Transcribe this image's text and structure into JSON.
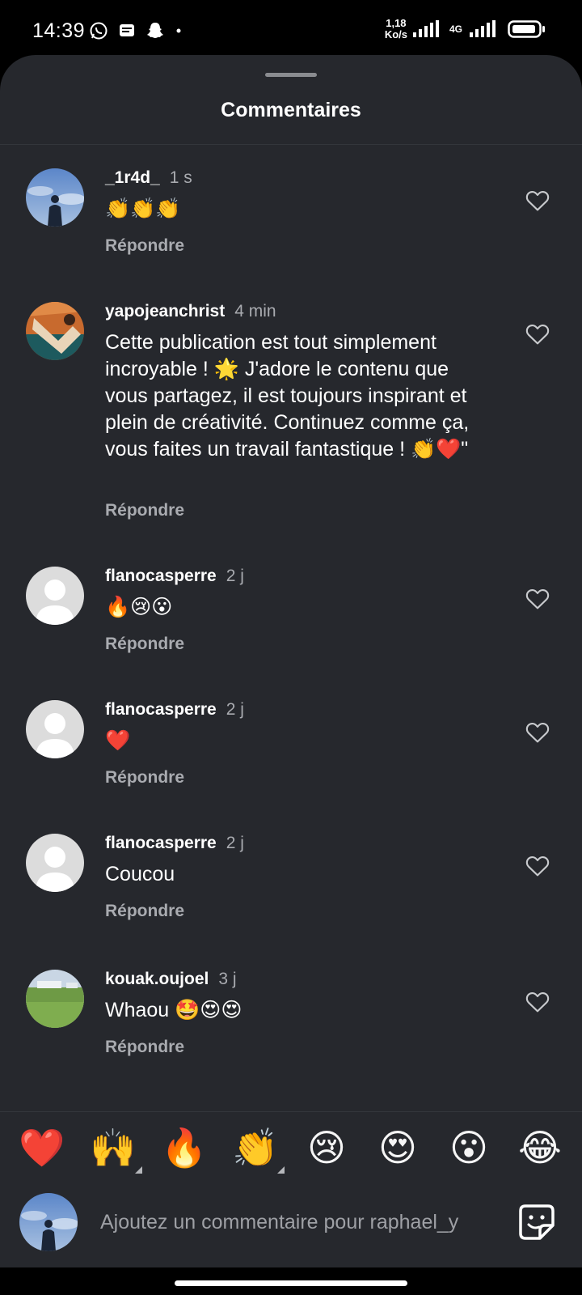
{
  "status_bar": {
    "time": "14:39",
    "net_speed_value": "1,18",
    "net_speed_unit": "Ko/s",
    "net_type": "4G",
    "icons": [
      "whatsapp-icon",
      "message-icon",
      "snapchat-icon",
      "dot-icon",
      "signal-icon",
      "signal-4g-icon",
      "battery-icon"
    ]
  },
  "sheet": {
    "title": "Commentaires"
  },
  "comments": [
    {
      "username": "_1r4d_",
      "time": "1 s",
      "text": "👏👏👏",
      "reply": "Répondre",
      "avatar": "photo-sky"
    },
    {
      "username": "yapojeanchrist",
      "time": "4 min",
      "text": "Cette publication est tout simplement incroyable ! 🌟 J'adore le contenu que vous partagez, il est toujours inspirant et plein de créativité. Continuez comme ça, vous faites un travail fantastique ! 👏❤️\"",
      "reply": "Répondre",
      "avatar": "photo-sport"
    },
    {
      "username": "flanocasperre",
      "time": "2 j",
      "text": "🔥😢😮",
      "reply": "Répondre",
      "avatar": "default"
    },
    {
      "username": "flanocasperre",
      "time": "2 j",
      "text": "❤️",
      "reply": "Répondre",
      "avatar": "default"
    },
    {
      "username": "flanocasperre",
      "time": "2 j",
      "text": "Coucou",
      "reply": "Répondre",
      "avatar": "default"
    },
    {
      "username": "kouak.oujoel",
      "time": "3 j",
      "text": "Whaou 🤩😍😍",
      "reply": "Répondre",
      "avatar": "photo-field"
    }
  ],
  "emoji_bar": [
    "❤️",
    "🙌",
    "🔥",
    "👏",
    "😢",
    "😍",
    "😮",
    "😂"
  ],
  "composer": {
    "placeholder": "Ajoutez un commentaire pour raphael_y",
    "sticker_icon": "sticker-icon"
  },
  "colors": {
    "sheet_background": "#26282d",
    "secondary_text": "#a9abb0",
    "primary_text": "#ffffff"
  }
}
